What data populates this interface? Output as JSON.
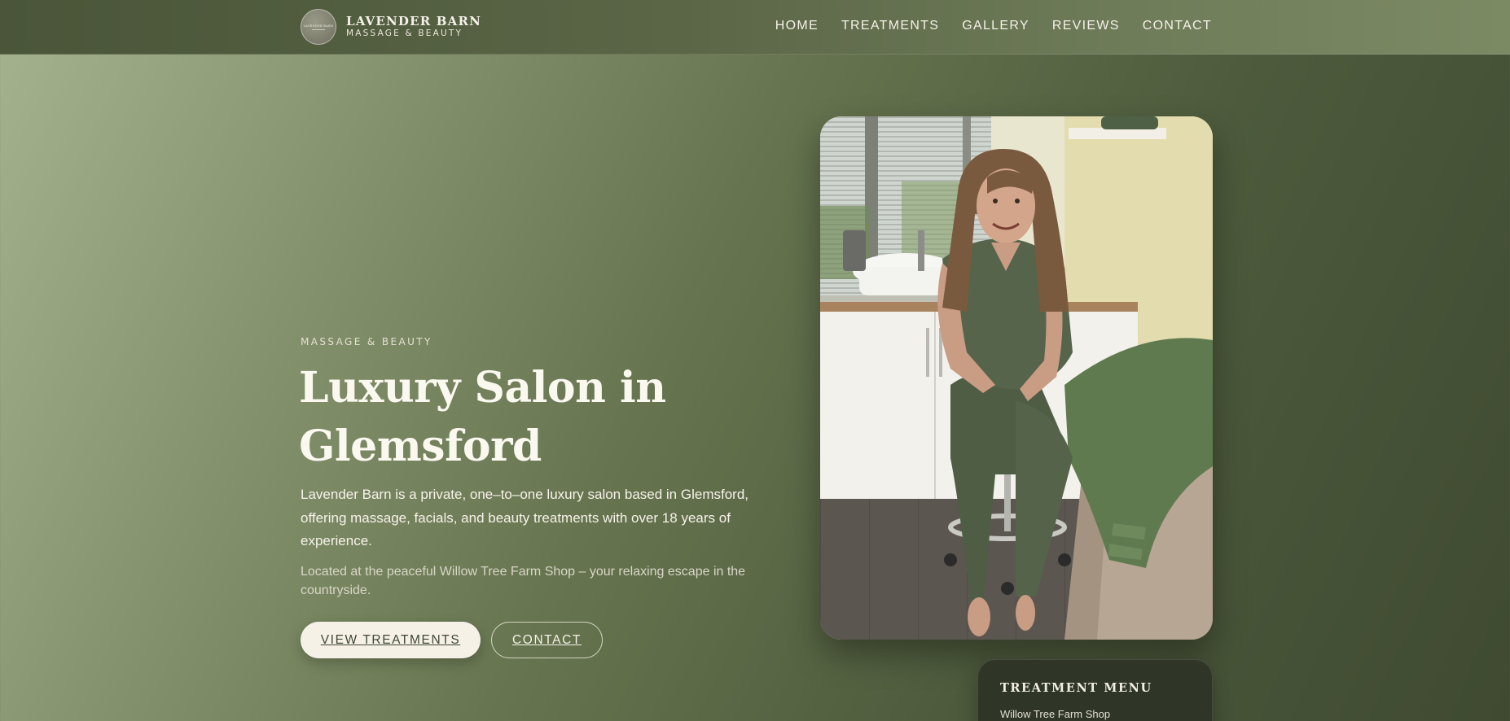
{
  "brand": {
    "name": "LAVENDER BARN",
    "subtitle": "MASSAGE & BEAUTY",
    "logo_text": "LAVENDER BARN"
  },
  "nav": {
    "items": [
      {
        "label": "HOME"
      },
      {
        "label": "TREATMENTS"
      },
      {
        "label": "GALLERY"
      },
      {
        "label": "REVIEWS"
      },
      {
        "label": "CONTACT"
      }
    ]
  },
  "hero": {
    "eyebrow": "MASSAGE & BEAUTY",
    "title": "Luxury Salon in Glemsford",
    "lead": "Lavender Barn is a private, one–to–one luxury salon based in Glemsford, offering massage, facials, and beauty treatments with over 18 years of experience.",
    "sub": "Located at the peaceful Willow Tree Farm Shop – your relaxing escape in the countryside.",
    "primary_button": "VIEW TREATMENTS",
    "secondary_button": "CONTACT"
  },
  "menu_card": {
    "title": "TREATMENT MENU",
    "location": "Willow Tree Farm Shop"
  },
  "colors": {
    "header_bg": "#5a6646",
    "hero_bg_light": "#a6b38f",
    "hero_bg_dark": "#3f4a31",
    "button_light": "#f6f1e7",
    "card_bg": "#2f3627"
  }
}
